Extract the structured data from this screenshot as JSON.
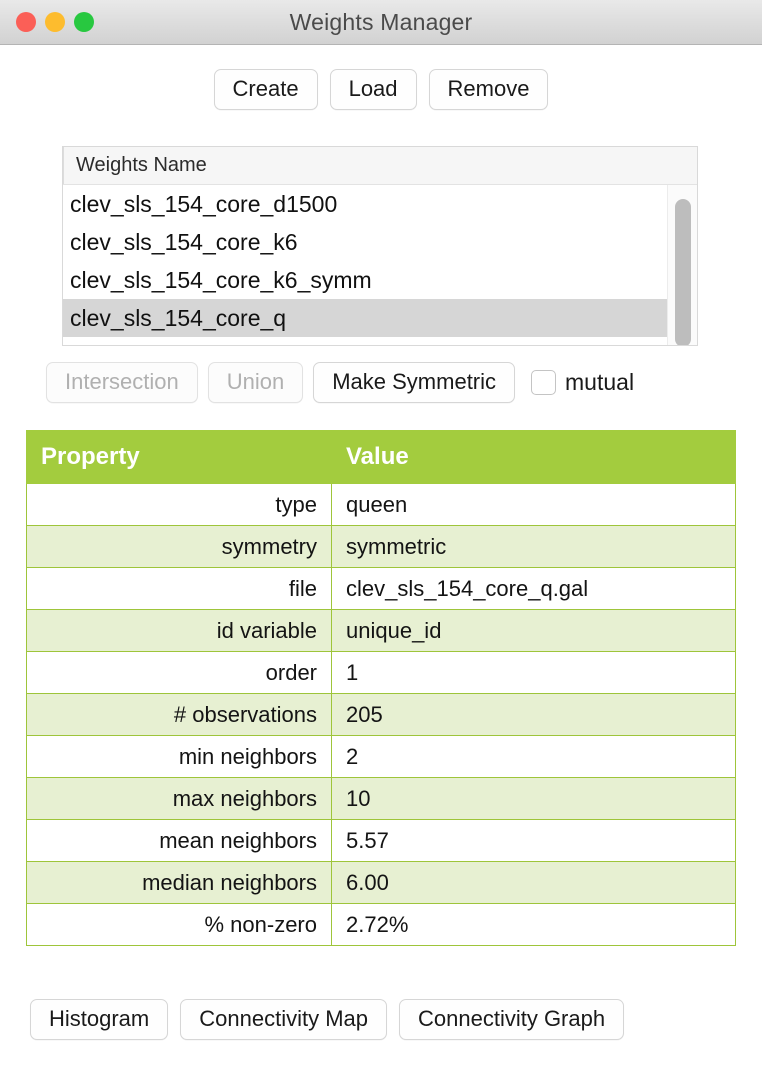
{
  "window": {
    "title": "Weights Manager",
    "controls": [
      {
        "name": "close",
        "color": "#fb5f57"
      },
      {
        "name": "minimize",
        "color": "#fdbc2e"
      },
      {
        "name": "maximize",
        "color": "#28c840"
      }
    ]
  },
  "toolbar": {
    "create_label": "Create",
    "load_label": "Load",
    "remove_label": "Remove"
  },
  "weights_list": {
    "column_header": "Weights Name",
    "items": [
      {
        "name": "clev_sls_154_core_d1500",
        "selected": false
      },
      {
        "name": "clev_sls_154_core_k6",
        "selected": false
      },
      {
        "name": "clev_sls_154_core_k6_symm",
        "selected": false
      },
      {
        "name": "clev_sls_154_core_q",
        "selected": true
      }
    ],
    "selected_item": "clev_sls_154_core_q"
  },
  "ops": {
    "intersection_label": "Intersection",
    "intersection_enabled": false,
    "union_label": "Union",
    "union_enabled": false,
    "make_symmetric_label": "Make Symmetric",
    "make_symmetric_enabled": true,
    "mutual_label": "mutual",
    "mutual_checked": false
  },
  "properties": {
    "headers": [
      "Property",
      "Value"
    ],
    "header_color": "#a3cc3e",
    "alt_row_color": "#e7f0d2",
    "rows": [
      {
        "property": "type",
        "value": "queen"
      },
      {
        "property": "symmetry",
        "value": "symmetric"
      },
      {
        "property": "file",
        "value": "clev_sls_154_core_q.gal"
      },
      {
        "property": "id variable",
        "value": "unique_id"
      },
      {
        "property": "order",
        "value": "1"
      },
      {
        "property": "# observations",
        "value": "205"
      },
      {
        "property": "min neighbors",
        "value": "2"
      },
      {
        "property": "max neighbors",
        "value": "10"
      },
      {
        "property": "mean neighbors",
        "value": "5.57"
      },
      {
        "property": "median neighbors",
        "value": "6.00"
      },
      {
        "property": "% non-zero",
        "value": "2.72%"
      }
    ]
  },
  "bottom": {
    "histogram_label": "Histogram",
    "connectivity_map_label": "Connectivity Map",
    "connectivity_graph_label": "Connectivity Graph"
  }
}
